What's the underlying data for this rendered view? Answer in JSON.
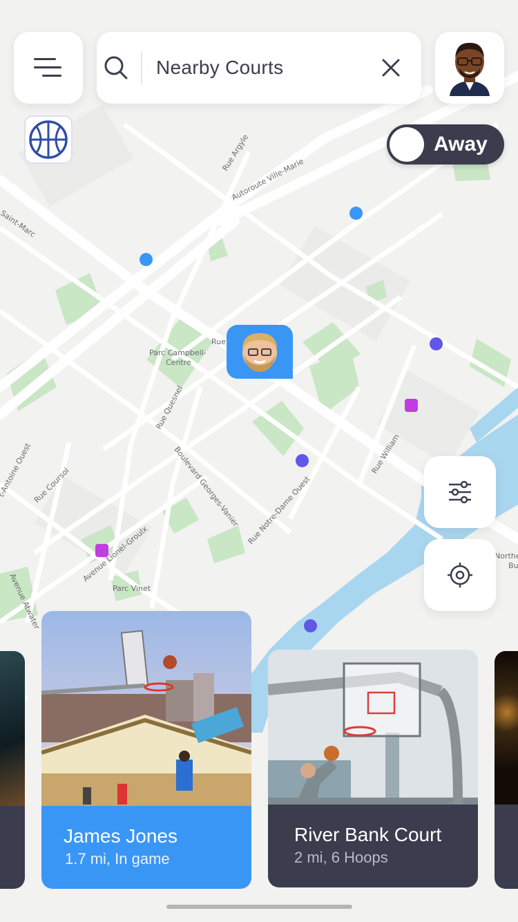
{
  "colors": {
    "accent": "#3a96f5",
    "dark": "#3b3d4e",
    "purple": "#5f57e8",
    "magenta": "#c13de2"
  },
  "search": {
    "label": "Nearby Courts"
  },
  "status_toggle": {
    "label": "Away"
  },
  "icons": {
    "menu": "menu-icon",
    "search": "search-icon",
    "close": "close-icon",
    "filter": "sliders-icon",
    "locate": "crosshair-icon",
    "basketball": "basketball-icon"
  },
  "map": {
    "labels": [
      "Rue Argyle",
      "Autoroute Ville-Marie",
      "Saint-Marc",
      "Parc Campbell-",
      "Centre",
      "Rue Quesnel",
      "Boulevard Georges-Vanier",
      "Rue Notre-Dame Ouest",
      "Rue William",
      "Rue Coursol",
      "t-Antoine Ouest",
      "Avenue Lionel-Groulx",
      "Parc Vinet",
      "Avenue Atwater",
      "Rue",
      "Northe",
      "Bu"
    ]
  },
  "cards": [
    {
      "title": "James Jones",
      "subtitle": "1.7 mi, In game"
    },
    {
      "title": "River Bank Court",
      "subtitle": "2 mi, 6 Hoops"
    }
  ]
}
